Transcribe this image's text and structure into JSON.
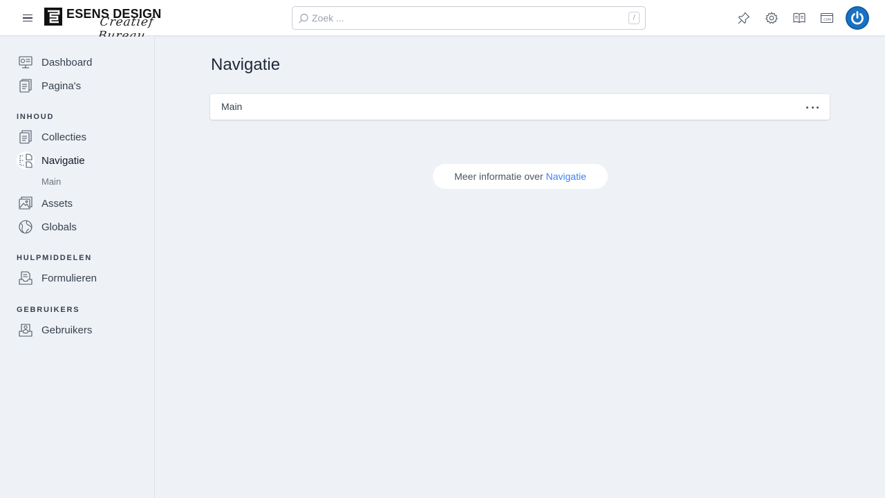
{
  "header": {
    "logo_text": "ESENS DESIGN",
    "logo_script": "Creatief Bureau",
    "search_placeholder": "Zoek ...",
    "search_shortcut": "/",
    "icons": [
      "pin-icon",
      "gear-icon",
      "book-icon",
      "site-com-icon"
    ],
    "avatar_color": "#1971c2"
  },
  "sidebar": {
    "items_top": [
      {
        "label": "Dashboard",
        "icon": "dashboard-icon"
      },
      {
        "label": "Pagina's",
        "icon": "pages-icon"
      }
    ],
    "section_content": "INHOUD",
    "items_content": [
      {
        "label": "Collecties",
        "icon": "collections-icon"
      },
      {
        "label": "Navigatie",
        "icon": "navigation-icon",
        "active": true
      },
      {
        "label": "Assets",
        "icon": "assets-icon"
      },
      {
        "label": "Globals",
        "icon": "globals-icon"
      }
    ],
    "sub_item": "Main",
    "section_tools": "HULPMIDDELEN",
    "items_tools": [
      {
        "label": "Formulieren",
        "icon": "forms-icon"
      }
    ],
    "section_users": "GEBRUIKERS",
    "items_users": [
      {
        "label": "Gebruikers",
        "icon": "users-icon"
      }
    ]
  },
  "main": {
    "title": "Navigatie",
    "card_title": "Main",
    "info_text": "Meer informatie over",
    "info_link": "Navigatie"
  },
  "colors": {
    "accent": "#3b82f6",
    "background": "#eef1f5"
  }
}
